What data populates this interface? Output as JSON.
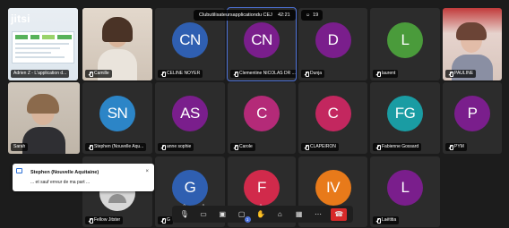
{
  "app": {
    "logo_text": "jitsi"
  },
  "meeting": {
    "title": "Clubutilisateursapplicationdu CEJ",
    "time": "42:21",
    "participant_count": "19"
  },
  "notification": {
    "sender": "Stephen (Nouvelle Aquitaine)",
    "message": "... et sauf erreur de ma part ...",
    "close_label": "×"
  },
  "tiles": [
    {
      "id": "adrien",
      "name": "Adrien Z - L'application d...",
      "type": "screen"
    },
    {
      "id": "camille",
      "name": "Camille",
      "type": "video"
    },
    {
      "id": "celine",
      "name": "CELINE NOYER",
      "initials": "CN",
      "color": "#2f5fb1"
    },
    {
      "id": "clementine",
      "name": "Clementine NICOLAS DR ...",
      "initials": "CN",
      "color": "#7a1e8c",
      "active": true
    },
    {
      "id": "dunja",
      "name": "Dunja",
      "initials": "D",
      "color": "#7a1e8c"
    },
    {
      "id": "laurent",
      "name": "laurent",
      "initials": "L",
      "color": "#4a9b3b"
    },
    {
      "id": "pauline",
      "name": "PAULINE",
      "type": "video"
    },
    {
      "id": "sarah",
      "name": "Sarah",
      "type": "video"
    },
    {
      "id": "stephen",
      "name": "Stephen (Nouvelle Aqu...",
      "initials": "SN",
      "color": "#2c85c7"
    },
    {
      "id": "annesophie",
      "name": "anne sophie",
      "initials": "AS",
      "color": "#7a1e8c"
    },
    {
      "id": "carole",
      "name": "Carole",
      "initials": "C",
      "color": "#b42a78"
    },
    {
      "id": "clapeiron",
      "name": "CLAPEIRON",
      "initials": "C",
      "color": "#c3275f"
    },
    {
      "id": "fabienne",
      "name": "Fabienne Gossard",
      "initials": "FG",
      "color": "#1a9ca3"
    },
    {
      "id": "pym",
      "name": "PYM",
      "initials": "P",
      "color": "#7a1e8c"
    },
    {
      "id": "fellow",
      "name": "Fellow Jitster",
      "type": "placeholder"
    },
    {
      "id": "g",
      "name": "G",
      "initials": "G",
      "color": "#2f5fb1"
    },
    {
      "id": "f",
      "name": "F",
      "initials": "F",
      "color": "#d12a4b"
    },
    {
      "id": "iv",
      "name": "IV",
      "initials": "IV",
      "color": "#e87a1a"
    },
    {
      "id": "laetitia",
      "name": "Laëtitia",
      "initials": "L",
      "color": "#7a1e8c"
    }
  ],
  "toolbar": {
    "mic_icon": "🎙",
    "camera_icon": "▭",
    "share_icon": "▣",
    "chat_icon": "▢",
    "chat_badge": "1",
    "raise_hand_icon": "✋",
    "reactions_icon": "⌂",
    "tile_view_icon": "▦",
    "more_icon": "⋯",
    "hangup_icon": "☎",
    "caret": "^"
  }
}
